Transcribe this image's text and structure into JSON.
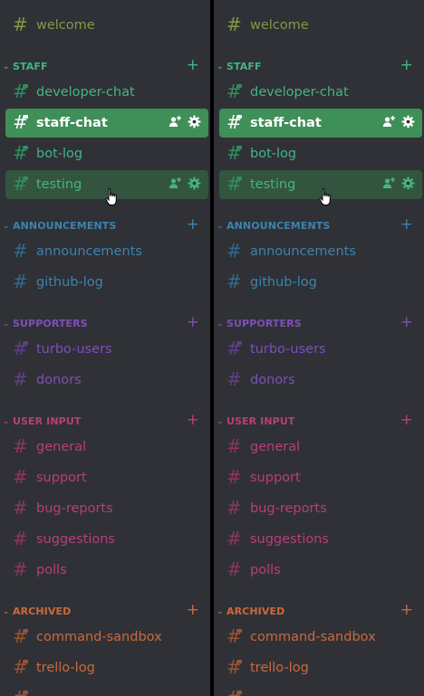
{
  "colors": {
    "panel_bg": "#2f3136",
    "divider": "#000000",
    "welcome": "#7f9a45",
    "staff": "#43b581",
    "staff_hash": "#318f5e",
    "staff_selected_bg": "#3f8f58",
    "staff_hover_bg": "#33553f",
    "announcements": "#3c83ad",
    "announcements_hash": "#2f6b8e",
    "supporters": "#7e4fb8",
    "supporters_hash": "#5f3f8a",
    "user_input": "#b83e7a",
    "user_input_hash": "#8e3460",
    "archived": "#c96a3e",
    "archived_hash": "#9a5431",
    "white": "#ffffff"
  },
  "panels": [
    {
      "channels": {
        "welcome": "welcome",
        "developer_chat": "developer-chat",
        "staff_chat": "staff-chat",
        "bot_log": "bot-log",
        "testing": "testing",
        "announcements": "announcements",
        "github_log": "github-log",
        "turbo_users": "turbo-users",
        "donors": "donors",
        "general": "general",
        "support": "support",
        "bug_reports": "bug-reports",
        "suggestions": "suggestions",
        "polls": "polls",
        "command_sandbox": "command-sandbox",
        "trello_log": "trello-log"
      },
      "categories": {
        "staff": "STAFF",
        "announcements": "ANNOUNCEMENTS",
        "supporters": "SUPPORTERS",
        "user_input": "USER INPUT",
        "archived": "ARCHIVED"
      }
    },
    {
      "channels": {
        "welcome": "welcome",
        "developer_chat": "developer-chat",
        "staff_chat": "staff-chat",
        "bot_log": "bot-log",
        "testing": "testing",
        "announcements": "announcements",
        "github_log": "github-log",
        "turbo_users": "turbo-users",
        "donors": "donors",
        "general": "general",
        "support": "support",
        "bug_reports": "bug-reports",
        "suggestions": "suggestions",
        "polls": "polls",
        "command_sandbox": "command-sandbox",
        "trello_log": "trello-log"
      },
      "categories": {
        "staff": "STAFF",
        "announcements": "ANNOUNCEMENTS",
        "supporters": "SUPPORTERS",
        "user_input": "USER INPUT",
        "archived": "ARCHIVED"
      }
    }
  ],
  "icons": {
    "hash": "#",
    "plus": "+",
    "chevron": "⌄",
    "invite": "add-member-icon",
    "gear": "gear-icon",
    "cursor": "hand-pointer-icon"
  }
}
